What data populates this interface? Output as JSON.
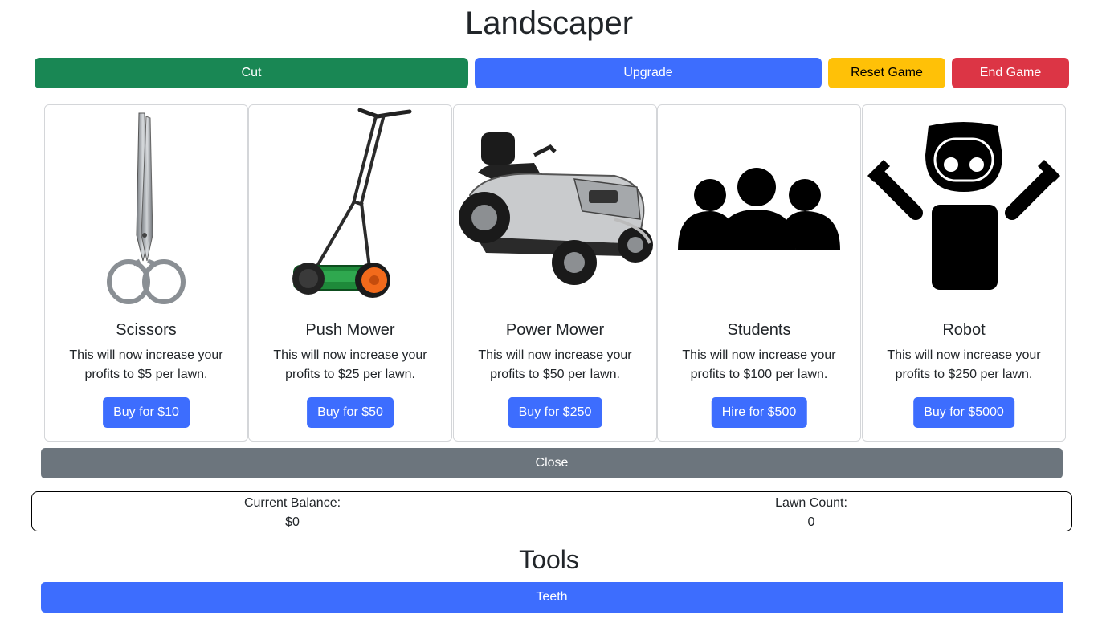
{
  "app": {
    "title": "Landscaper"
  },
  "actions": {
    "cut": "Cut",
    "upgrade": "Upgrade",
    "reset": "Reset Game",
    "end": "End Game"
  },
  "colors": {
    "cut": "#198754",
    "primary": "#3d6dfe",
    "reset": "#ffc107",
    "end": "#dc3545",
    "close": "#6c757d"
  },
  "upgrades": [
    {
      "name": "Scissors",
      "description": "This will now increase your profits to $5 per lawn.",
      "button": "Buy for $10",
      "icon": "scissors-image"
    },
    {
      "name": "Push Mower",
      "description": "This will now increase your profits to $25 per lawn.",
      "button": "Buy for $50",
      "icon": "push-mower-image"
    },
    {
      "name": "Power Mower",
      "description": "This will now increase your profits to $50 per lawn.",
      "button": "Buy for $250",
      "icon": "power-mower-image"
    },
    {
      "name": "Students",
      "description": "This will now increase your profits to $100 per lawn.",
      "button": "Hire for $500",
      "icon": "students-icon"
    },
    {
      "name": "Robot",
      "description": "This will now increase your profits to $250 per lawn.",
      "button": "Buy for $5000",
      "icon": "robot-icon"
    }
  ],
  "close_label": "Close",
  "stats": {
    "balance_label": "Current Balance:",
    "balance_value": "$0",
    "lawns_label": "Lawn Count:",
    "lawns_value": "0"
  },
  "tools": {
    "title": "Tools",
    "items": [
      "Teeth"
    ]
  }
}
